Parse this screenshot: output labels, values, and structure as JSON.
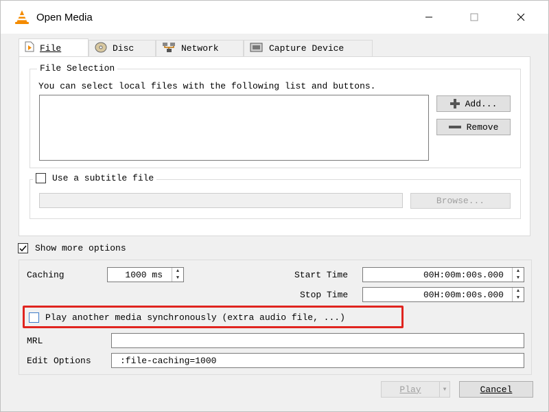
{
  "window": {
    "title": "Open Media",
    "minimize_glyph": "—",
    "maximize_glyph": "☐",
    "close_glyph": "✕"
  },
  "tabs": [
    {
      "label": "File",
      "icon": "file-icon",
      "active": true
    },
    {
      "label": "Disc",
      "icon": "disc-icon",
      "active": false
    },
    {
      "label": "Network",
      "icon": "network-icon",
      "active": false
    },
    {
      "label": "Capture Device",
      "icon": "capture-device-icon",
      "active": false
    }
  ],
  "file_selection": {
    "legend": "File Selection",
    "description": "You can select local files with the following list and buttons.",
    "add_label": "Add...",
    "remove_label": "Remove"
  },
  "subtitle": {
    "label": "Use a subtitle file",
    "checked": false,
    "path_value": "",
    "browse_label": "Browse..."
  },
  "show_more": {
    "label": "Show more options",
    "checked": true
  },
  "options": {
    "caching_label": "Caching",
    "caching_value": "1000 ms",
    "start_time_label": "Start Time",
    "start_time_value": "00H:00m:00s.000",
    "stop_time_label": "Stop Time",
    "stop_time_value": "00H:00m:00s.000",
    "play_another_label": "Play another media synchronously (extra audio file, ...)",
    "play_another_checked": false,
    "mrl_label": "MRL",
    "mrl_value": "",
    "edit_options_label": "Edit Options",
    "edit_options_value": ":file-caching=1000"
  },
  "footer": {
    "play_label": "Play",
    "cancel_label": "Cancel"
  },
  "colors": {
    "highlight": "#e0241f",
    "vlc_orange": "#f48b00"
  }
}
